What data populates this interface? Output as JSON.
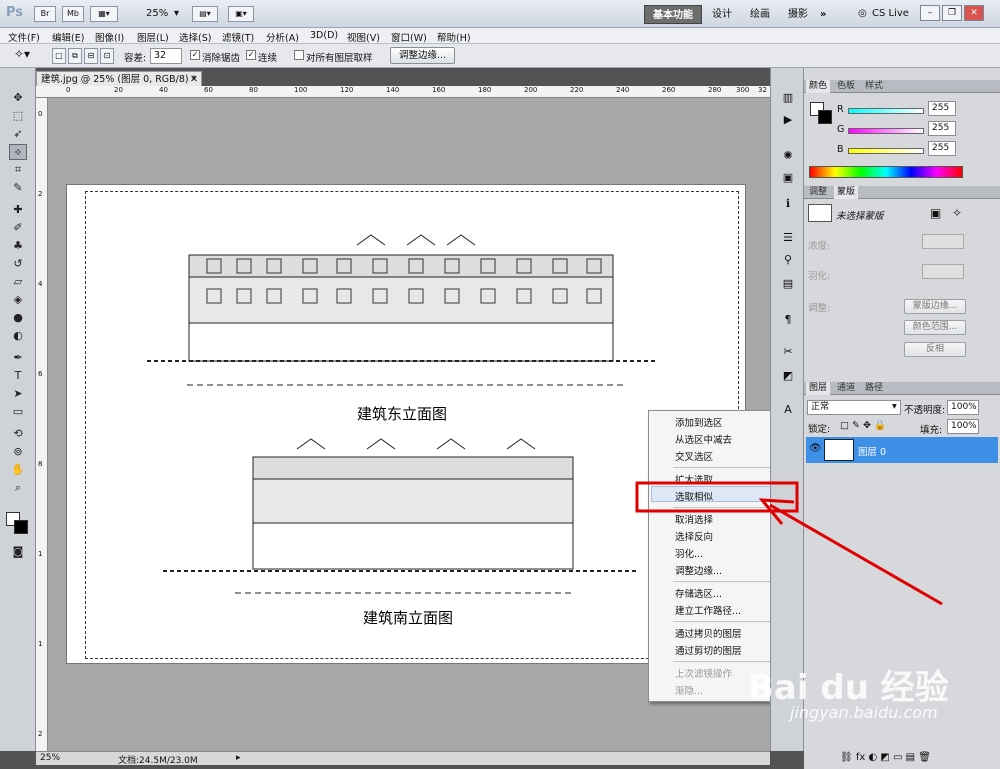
{
  "appbar": {
    "logo": "Ps",
    "br": "Br",
    "mb": "Mb",
    "zoom": "25%",
    "workspaces": [
      "基本功能",
      "设计",
      "绘画",
      "摄影"
    ],
    "more": "»",
    "cs_live": "CS Live"
  },
  "menu": [
    "文件(F)",
    "编辑(E)",
    "图像(I)",
    "图层(L)",
    "选择(S)",
    "滤镜(T)",
    "分析(A)",
    "3D(D)",
    "视图(V)",
    "窗口(W)",
    "帮助(H)"
  ],
  "options": {
    "tolerance_label": "容差:",
    "tolerance_value": "32",
    "antialias": "消除锯齿",
    "contiguous": "连续",
    "all_layers": "对所有图层取样",
    "refine_edge": "调整边缘..."
  },
  "document": {
    "tab_title": "建筑.jpg @ 25% (图层 0, RGB/8) *",
    "ruler_h": [
      "0",
      "20",
      "40",
      "60",
      "80",
      "100",
      "120",
      "140",
      "160",
      "180",
      "200",
      "220",
      "240",
      "260",
      "280",
      "300",
      "32"
    ],
    "ruler_v": [
      "0",
      "2",
      "4",
      "6",
      "8",
      "1",
      "1",
      "2"
    ],
    "status_zoom": "25%",
    "status_doc": "文档:24.5M/23.0M"
  },
  "context_menu": {
    "items": [
      {
        "label": "添加到选区",
        "disabled": false
      },
      {
        "label": "从选区中减去",
        "disabled": false
      },
      {
        "label": "交叉选区",
        "disabled": false
      },
      {
        "label": "扩大选取",
        "disabled": false
      },
      {
        "label": "选取相似",
        "disabled": false
      },
      {
        "label": "取消选择",
        "disabled": false
      },
      {
        "label": "选择反向",
        "disabled": false
      },
      {
        "label": "羽化...",
        "disabled": false
      },
      {
        "label": "调整边缘...",
        "disabled": false
      },
      {
        "label": "存储选区...",
        "disabled": false
      },
      {
        "label": "建立工作路径...",
        "disabled": false
      },
      {
        "label": "通过拷贝的图层",
        "disabled": false
      },
      {
        "label": "通过剪切的图层",
        "disabled": false
      },
      {
        "label": "上次滤镜操作",
        "disabled": true
      },
      {
        "label": "渐隐...",
        "disabled": true
      }
    ],
    "highlighted": "选取相似"
  },
  "color_panel": {
    "tabs": [
      "颜色",
      "色板",
      "样式"
    ],
    "r_label": "R",
    "r_value": "255",
    "g_label": "G",
    "g_value": "255",
    "b_label": "B",
    "b_value": "255"
  },
  "adjust_panel": {
    "tabs": [
      "调整",
      "蒙版"
    ],
    "mask_label": "未选择蒙版",
    "density_label": "浓度:",
    "feather_label": "羽化:",
    "refine_label": "调整:",
    "btn_mask_edge": "蒙版边缘...",
    "btn_color_range": "颜色范围...",
    "btn_invert": "反相"
  },
  "layers_panel": {
    "tabs": [
      "图层",
      "通道",
      "路径"
    ],
    "blend_mode": "正常",
    "opacity_label": "不透明度:",
    "opacity_value": "100%",
    "lock_label": "锁定:",
    "fill_label": "填充:",
    "fill_value": "100%",
    "layer_name": "图层 0"
  },
  "drawing": {
    "caption_top": "建筑东立面图",
    "caption_bottom": "建筑南立面图"
  },
  "watermark": {
    "brand": "Bai du 经验",
    "url": "jingyan.baidu.com"
  },
  "colors": {
    "highlight_red": "#e00000",
    "layer_selected": "#3e8fe6"
  }
}
